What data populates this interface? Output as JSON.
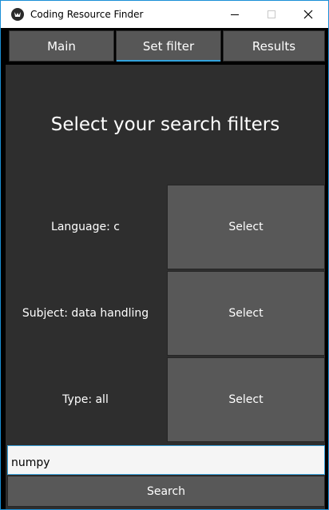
{
  "window": {
    "title": "Coding Resource Finder",
    "icon": "app-logo-icon",
    "controls": [
      "minimize-icon",
      "maximize-icon",
      "close-icon"
    ]
  },
  "tabs": [
    {
      "label": "Main",
      "active": false
    },
    {
      "label": "Set filter",
      "active": true
    },
    {
      "label": "Results",
      "active": false
    }
  ],
  "filter_panel": {
    "heading": "Select your search filters",
    "filters": [
      {
        "label": "Language: c",
        "button": "Select"
      },
      {
        "label": "Subject: data handling",
        "button": "Select"
      },
      {
        "label": "Type: all",
        "button": "Select"
      }
    ]
  },
  "search": {
    "value": "numpy",
    "button_label": "Search"
  },
  "colors": {
    "accent": "#33a3dc",
    "panel_bg": "#2e2e2e",
    "button_bg": "#585858"
  }
}
